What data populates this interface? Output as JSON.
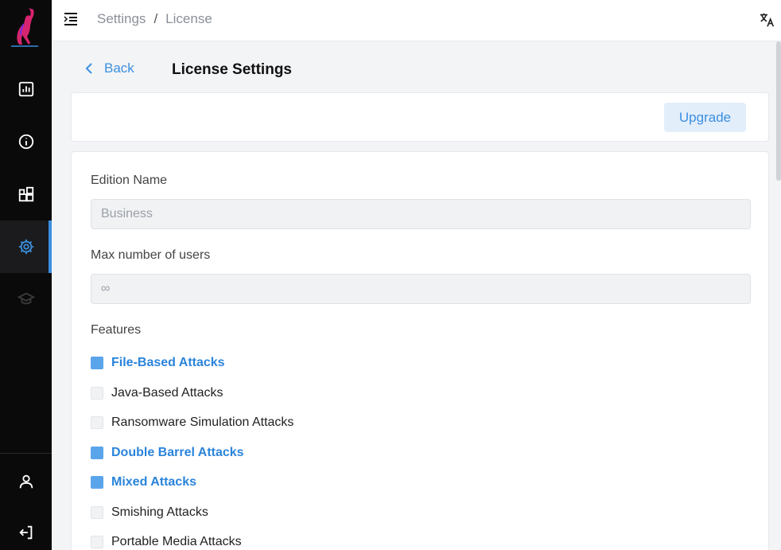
{
  "topbar": {
    "breadcrumb": [
      "Settings",
      "License"
    ],
    "separator": "/"
  },
  "sidebar": {
    "items": [
      {
        "name": "dashboard",
        "icon": "chart-icon"
      },
      {
        "name": "info",
        "icon": "info-icon"
      },
      {
        "name": "modules",
        "icon": "blocks-icon"
      },
      {
        "name": "settings",
        "icon": "gear-icon",
        "active": true
      },
      {
        "name": "training",
        "icon": "graduation-cap-icon"
      }
    ],
    "bottom": [
      {
        "name": "profile",
        "icon": "user-icon"
      },
      {
        "name": "logout",
        "icon": "logout-icon"
      }
    ]
  },
  "page": {
    "back_label": "Back",
    "title": "License Settings",
    "upgrade_label": "Upgrade"
  },
  "form": {
    "edition_label": "Edition Name",
    "edition_value": "Business",
    "max_users_label": "Max number of users",
    "max_users_value": "∞",
    "features_label": "Features",
    "features": [
      {
        "label": "File-Based Attacks",
        "checked": true
      },
      {
        "label": "Java-Based Attacks",
        "checked": false
      },
      {
        "label": "Ransomware Simulation Attacks",
        "checked": false
      },
      {
        "label": "Double Barrel Attacks",
        "checked": true
      },
      {
        "label": "Mixed Attacks",
        "checked": true
      },
      {
        "label": "Smishing Attacks",
        "checked": false
      },
      {
        "label": "Portable Media Attacks",
        "checked": false
      }
    ]
  },
  "colors": {
    "accent": "#3b8fe0",
    "sidebar_bg": "#0a0a0a"
  }
}
